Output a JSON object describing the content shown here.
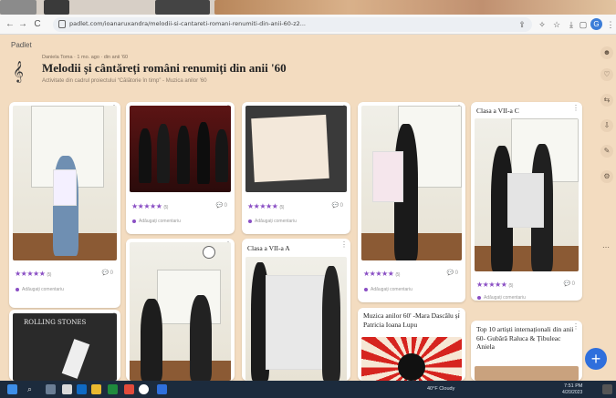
{
  "browser": {
    "url": "padlet.com/ioanaruxandra/melodii-si-cantareti-romani-renumiti-din-anii-60-z2...",
    "nav_back": "←",
    "nav_forward": "→",
    "nav_reload": "C",
    "avatar_initial": "G"
  },
  "header": {
    "brand": "Padlet",
    "author_line": "Daniela Toma · 1 mo. ago · din anii ’60",
    "title": "Melodii și cântăreți români renumiți din anii '60",
    "subtitle": "Activitate din cadrul proiectului “Călătorie în timp” - Muzica anilor '60"
  },
  "cards": [
    {
      "id": "c1",
      "stars": "★★★★★",
      "star_count": "(5)",
      "comments": "0",
      "add_comment": "Adăugați comentariu"
    },
    {
      "id": "c2",
      "stars": "★★★★★",
      "star_count": "(5)",
      "comments": "0",
      "add_comment": "Adăugați comentariu"
    },
    {
      "id": "c3",
      "stars": "★★★★★",
      "star_count": "(5)",
      "comments": "0",
      "add_comment": "Adăugați comentariu"
    },
    {
      "id": "c4",
      "stars": "★★★★★",
      "star_count": "(5)",
      "comments": "0",
      "add_comment": "Adăugați comentariu"
    },
    {
      "id": "c5",
      "title": "Clasa a VII-a C",
      "stars": "★★★★★",
      "star_count": "(5)",
      "comments": "0",
      "add_comment": "Adăugați comentariu"
    },
    {
      "id": "c6",
      "title": "ROLLING STONES"
    },
    {
      "id": "c7"
    },
    {
      "id": "c8",
      "title": "Clasa a VII-a A"
    },
    {
      "id": "c9",
      "title": "Muzica anilor 60' -Mara Dascălu și Patricia Ioana Lupu"
    },
    {
      "id": "c10",
      "title": "Top 10 artiști internaționali din anii 60- Gubără Raluca & Țibuleac Aniela"
    }
  ],
  "fab_label": "+",
  "taskbar": {
    "weather": "40°F Cloudy",
    "time": "7:51 PM",
    "date": "4/20/2023"
  },
  "colors": {
    "background": "#f3dcc0",
    "accent_purple": "#8a4fc4",
    "fab_blue": "#2f6fdc",
    "taskbar": "#1c2b3d"
  }
}
